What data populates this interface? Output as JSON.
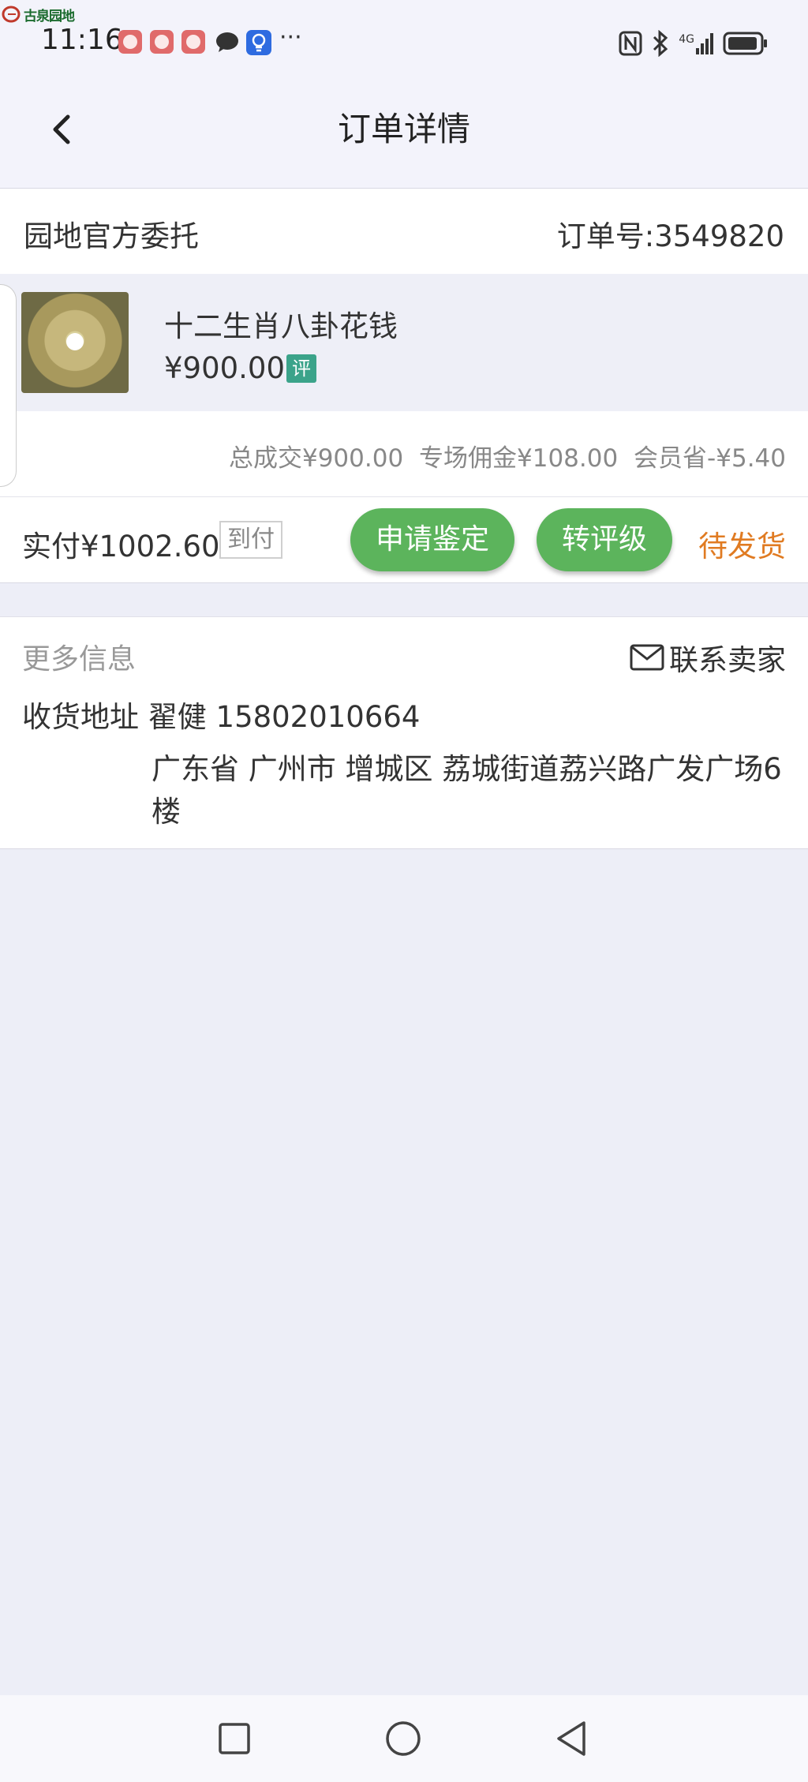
{
  "status_bar": {
    "watermark": "古泉园地",
    "time": "11:16",
    "more_notifications": "···",
    "network": "4G"
  },
  "nav": {
    "title": "订单详情"
  },
  "order": {
    "seller": "园地官方委托",
    "order_number": "订单号:3549820"
  },
  "item": {
    "name": "十二生肖八卦花钱",
    "price": "¥900.00",
    "badge": "评"
  },
  "summary": {
    "text": "总成交¥900.00 专场佣金¥108.00 会员省-¥5.40"
  },
  "payment": {
    "paid": "实付¥1002.60",
    "cod_tag": "到付",
    "appraise_button": "申请鉴定",
    "grade_button": "转评级",
    "status": "待发货"
  },
  "more_info": {
    "title": "更多信息",
    "contact_seller": "联系卖家",
    "address_label": "收货地址 翟健 15802010664",
    "address_line": "广东省 广州市 增城区 荔城街道荔兴路广发广场6楼"
  },
  "colors": {
    "accent_green": "#5cb45c",
    "status_orange": "#e07b22",
    "badge_teal": "#3ba38a"
  }
}
